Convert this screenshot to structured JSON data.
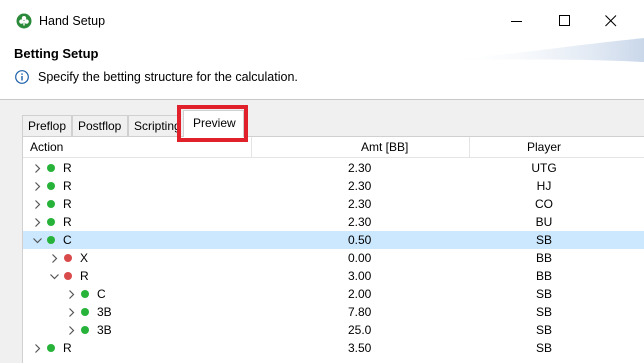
{
  "window": {
    "title": "Hand Setup",
    "app_icon": "club-icon"
  },
  "banner": {
    "title": "Betting Setup",
    "message": "Specify the betting structure for the calculation."
  },
  "tabs": [
    {
      "label": "Preflop"
    },
    {
      "label": "Postflop"
    },
    {
      "label": "Scripting"
    },
    {
      "label": "Preview",
      "active": true
    }
  ],
  "table": {
    "headers": {
      "action": "Action",
      "amount": "Amt [BB]",
      "player": "Player"
    },
    "rows": [
      {
        "action": "R",
        "amount": "2.30",
        "player": "UTG",
        "depth": 0,
        "expanded": false,
        "status": "green"
      },
      {
        "action": "R",
        "amount": "2.30",
        "player": "HJ",
        "depth": 0,
        "expanded": false,
        "status": "green"
      },
      {
        "action": "R",
        "amount": "2.30",
        "player": "CO",
        "depth": 0,
        "expanded": false,
        "status": "green"
      },
      {
        "action": "R",
        "amount": "2.30",
        "player": "BU",
        "depth": 0,
        "expanded": false,
        "status": "green"
      },
      {
        "action": "C",
        "amount": "0.50",
        "player": "SB",
        "depth": 0,
        "expanded": true,
        "status": "green",
        "selected": true
      },
      {
        "action": "X",
        "amount": "0.00",
        "player": "BB",
        "depth": 1,
        "expanded": false,
        "status": "red"
      },
      {
        "action": "R",
        "amount": "3.00",
        "player": "BB",
        "depth": 1,
        "expanded": true,
        "status": "red"
      },
      {
        "action": "C",
        "amount": "2.00",
        "player": "SB",
        "depth": 2,
        "expanded": false,
        "status": "green"
      },
      {
        "action": "3B",
        "amount": "7.80",
        "player": "SB",
        "depth": 2,
        "expanded": false,
        "status": "green"
      },
      {
        "action": "3B",
        "amount": "25.0",
        "player": "SB",
        "depth": 2,
        "expanded": false,
        "status": "green"
      },
      {
        "action": "R",
        "amount": "3.50",
        "player": "SB",
        "depth": 0,
        "expanded": false,
        "status": "green"
      }
    ]
  },
  "colors": {
    "selection": "#cce8ff",
    "highlight": "#e0202a",
    "status_green": "#27b33a",
    "status_red": "#d94a4a"
  }
}
